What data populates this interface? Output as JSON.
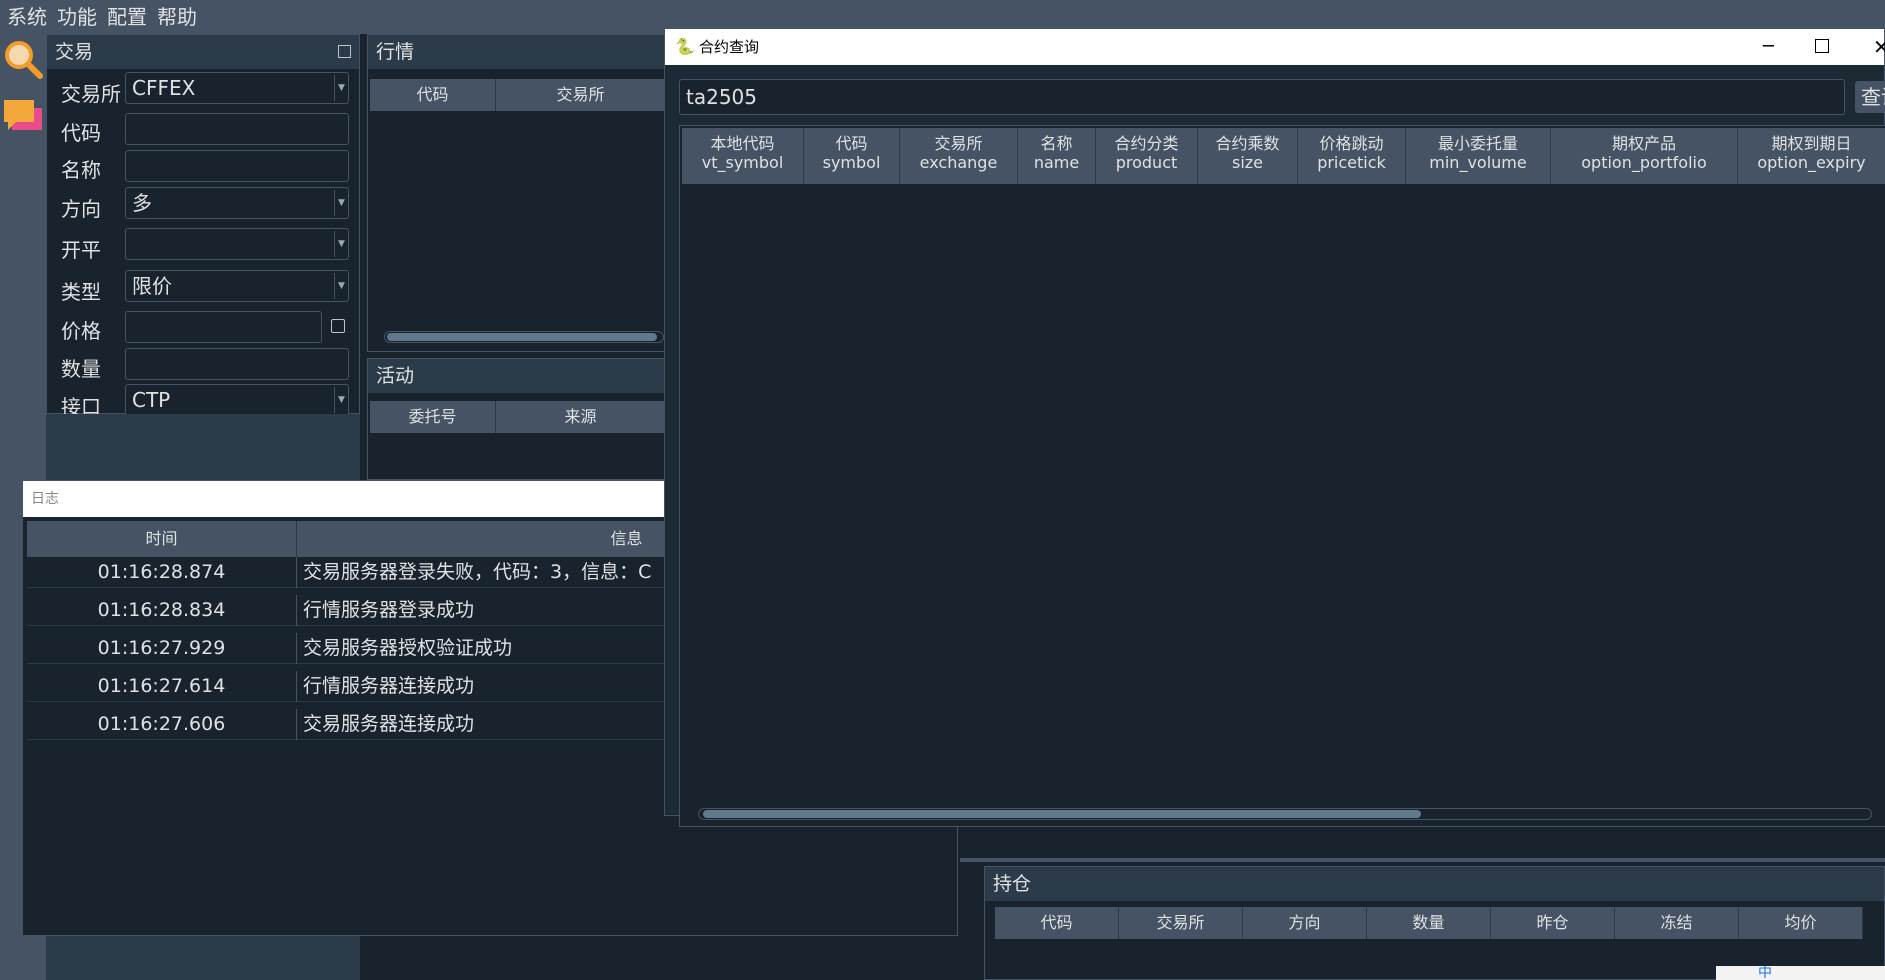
{
  "menubar": [
    "系统",
    "功能",
    "配置",
    "帮助"
  ],
  "toolbar": {
    "items": [
      "search-icon",
      "chat-icon"
    ]
  },
  "trade_panel": {
    "title": "交易",
    "fields": {
      "exchange": {
        "label": "交易所",
        "value": "CFFEX"
      },
      "symbol": {
        "label": "代码",
        "value": ""
      },
      "name": {
        "label": "名称",
        "value": ""
      },
      "direction": {
        "label": "方向",
        "value": "多"
      },
      "offset": {
        "label": "开平",
        "value": ""
      },
      "type": {
        "label": "类型",
        "value": "限价"
      },
      "price": {
        "label": "价格",
        "value": ""
      },
      "volume": {
        "label": "数量",
        "value": ""
      },
      "gateway": {
        "label": "接口",
        "value": "CTP"
      }
    }
  },
  "market_panel": {
    "title": "行情",
    "columns": [
      "代码",
      "交易所"
    ]
  },
  "activity_panel": {
    "title": "活动",
    "columns": [
      "委托号",
      "来源"
    ]
  },
  "position_panel": {
    "title": "持仓",
    "columns": [
      "代码",
      "交易所",
      "方向",
      "数量",
      "昨仓",
      "冻结",
      "均价"
    ]
  },
  "log_window": {
    "title": "日志",
    "columns": [
      "时间",
      "信息"
    ],
    "rows": [
      {
        "time": "01:16:28.874",
        "msg": "交易服务器登录失败，代码：3，信息：C"
      },
      {
        "time": "01:16:28.834",
        "msg": "行情服务器登录成功"
      },
      {
        "time": "01:16:27.929",
        "msg": "交易服务器授权验证成功"
      },
      {
        "time": "01:16:27.614",
        "msg": "行情服务器连接成功"
      },
      {
        "time": "01:16:27.606",
        "msg": "交易服务器连接成功"
      }
    ]
  },
  "contract_window": {
    "title": "合约查询",
    "search_value": "ta2505",
    "query_button": "查询",
    "window_controls": [
      "minimize-icon",
      "maximize-icon",
      "close-icon"
    ],
    "columns": [
      {
        "cn": "本地代码",
        "en": "vt_symbol"
      },
      {
        "cn": "代码",
        "en": "symbol"
      },
      {
        "cn": "交易所",
        "en": "exchange"
      },
      {
        "cn": "名称",
        "en": "name"
      },
      {
        "cn": "合约分类",
        "en": "product"
      },
      {
        "cn": "合约乘数",
        "en": "size"
      },
      {
        "cn": "价格跳动",
        "en": "pricetick"
      },
      {
        "cn": "最小委托量",
        "en": "min_volume"
      },
      {
        "cn": "期权产品",
        "en": "option_portfolio"
      },
      {
        "cn": "期权到期日",
        "en": "option_expiry"
      }
    ]
  },
  "ime_bar": {
    "text": "中"
  }
}
